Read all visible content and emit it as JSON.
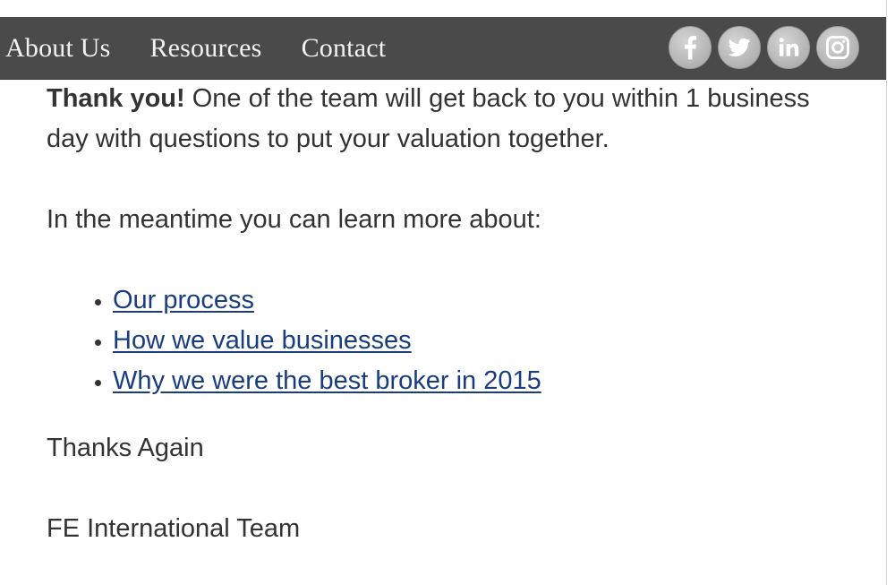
{
  "nav": {
    "links": [
      "About Us",
      "Resources",
      "Contact"
    ],
    "social": [
      {
        "icon": "facebook-icon",
        "label": "f"
      },
      {
        "icon": "twitter-icon",
        "label": ""
      },
      {
        "icon": "linkedin-icon",
        "label": "in"
      },
      {
        "icon": "instagram-icon",
        "label": ""
      }
    ]
  },
  "content": {
    "thank_you_bold": "Thank you!",
    "thank_you_text": " One of the team will get back to you within 1 business day with questions to put your valuation together.",
    "meantime": "In the meantime you can learn more about:",
    "links": [
      "Our process",
      "How we value businesses",
      "Why we were the best broker in 2015"
    ],
    "thanks_again": "Thanks Again",
    "signature": "FE International Team"
  },
  "colors": {
    "nav_bg": "#4a4a4a",
    "link": "#1a3d80",
    "text": "#333333"
  }
}
